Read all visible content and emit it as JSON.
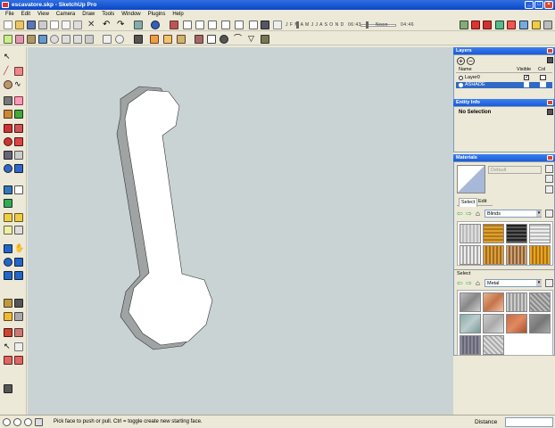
{
  "window": {
    "title": "escavatore.skp - SketchUp Pro"
  },
  "menu": [
    "File",
    "Edit",
    "View",
    "Camera",
    "Draw",
    "Tools",
    "Window",
    "Plugins",
    "Help"
  ],
  "shadow_bar": {
    "months": "J F M A M J J A S O N D",
    "time_start": "06:43",
    "noon": "Noon",
    "time_end": "04:46"
  },
  "layers": {
    "title": "Layers",
    "col_name": "Name",
    "col_visible": "Visible",
    "col_color": "Col",
    "rows": [
      {
        "name": "Layer0",
        "visible": true,
        "color": "#ffffff"
      },
      {
        "name": "ASHADE",
        "visible": true,
        "color": "#ffffff"
      }
    ]
  },
  "entity_info": {
    "title": "Entity Info",
    "selection": "No Selection"
  },
  "materials": {
    "title": "Materials",
    "current": "Default",
    "tab_select": "Select",
    "tab_edit": "Edit",
    "library1": "Blinds",
    "section2": "Select",
    "library2": "Metal"
  },
  "status": {
    "hint": "Pick face to push or pull.  Ctrl = toggle create new starting face.",
    "distance_label": "Distance",
    "distance_value": ""
  },
  "colors": {
    "titlebar": "#0a46c8",
    "viewport": "#c9d3d4",
    "panel_header": "#1d5ad6"
  }
}
